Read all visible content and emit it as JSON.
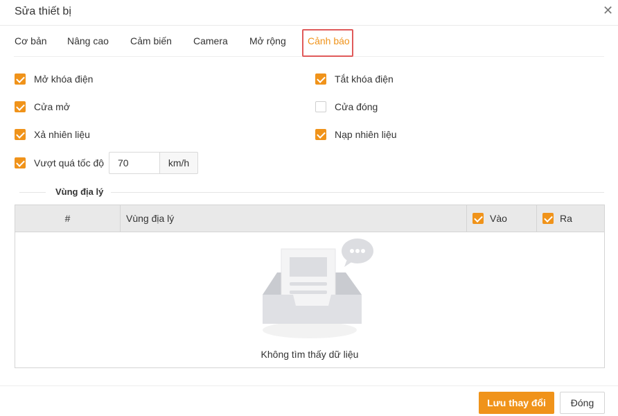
{
  "dialog": {
    "title": "Sửa thiết bị",
    "close_icon": "close-icon"
  },
  "tabs": [
    {
      "label": "Cơ bản",
      "active": false
    },
    {
      "label": "Nâng cao",
      "active": false
    },
    {
      "label": "Cảm biến",
      "active": false
    },
    {
      "label": "Camera",
      "active": false
    },
    {
      "label": "Mở rộng",
      "active": false
    },
    {
      "label": "Cảnh báo",
      "active": true
    }
  ],
  "alerts": {
    "ignition_on": {
      "label": "Mở khóa điện",
      "checked": true
    },
    "ignition_off": {
      "label": "Tắt khóa điện",
      "checked": true
    },
    "door_open": {
      "label": "Cửa mở",
      "checked": true
    },
    "door_close": {
      "label": "Cửa đóng",
      "checked": false
    },
    "fuel_drain": {
      "label": "Xả nhiên liệu",
      "checked": true
    },
    "fuel_fill": {
      "label": "Nạp nhiên liệu",
      "checked": true
    },
    "overspeed": {
      "label": "Vượt quá tốc độ",
      "checked": true,
      "value": "70",
      "unit": "km/h"
    }
  },
  "geofence": {
    "section_title": "Vùng địa lý",
    "columns": {
      "index": "#",
      "zone": "Vùng địa lý",
      "enter": {
        "label": "Vào",
        "checked": true
      },
      "exit": {
        "label": "Ra",
        "checked": true
      }
    },
    "empty_text": "Không tìm thấy dữ liệu"
  },
  "footer": {
    "save_label": "Lưu thay đổi",
    "close_label": "Đóng"
  },
  "colors": {
    "accent": "#f0931a",
    "highlight_border": "#e05a5a"
  }
}
